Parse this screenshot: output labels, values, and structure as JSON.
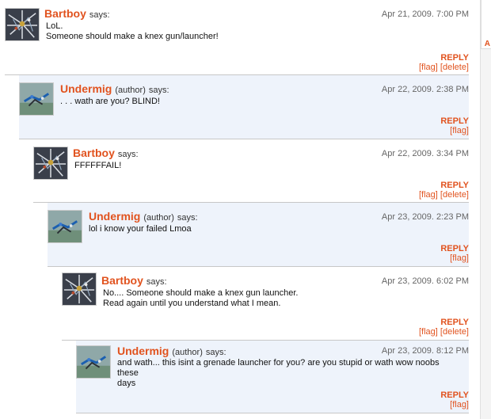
{
  "comments": [
    {
      "username": "Bartboy",
      "author_tag": "",
      "says": "says:",
      "date": "Apr 21, 2009. 7:00 PM",
      "lines": [
        "LoL.",
        "Someone should make a knex gun/launcher!"
      ],
      "reply_label": "REPLY",
      "flag_label": "[flag]",
      "delete_label": "[delete]",
      "avatar": "bartboy-avatar"
    },
    {
      "username": "Undermig",
      "author_tag": "(author)",
      "says": "says:",
      "date": "Apr 22, 2009. 2:38 PM",
      "lines": [
        ". . . wath are you? BLIND!"
      ],
      "reply_label": "REPLY",
      "flag_label": "[flag]",
      "delete_label": "",
      "avatar": "undermig-avatar"
    },
    {
      "username": "Bartboy",
      "author_tag": "",
      "says": "says:",
      "date": "Apr 22, 2009. 3:34 PM",
      "lines": [
        "FFFFFFAIL!"
      ],
      "reply_label": "REPLY",
      "flag_label": "[flag]",
      "delete_label": "[delete]",
      "avatar": "bartboy-avatar"
    },
    {
      "username": "Undermig",
      "author_tag": "(author)",
      "says": "says:",
      "date": "Apr 23, 2009. 2:23 PM",
      "lines": [
        "lol i know your failed Lmoa"
      ],
      "reply_label": "REPLY",
      "flag_label": "[flag]",
      "delete_label": "",
      "avatar": "undermig-avatar"
    },
    {
      "username": "Bartboy",
      "author_tag": "",
      "says": "says:",
      "date": "Apr 23, 2009. 6:02 PM",
      "lines": [
        "No.... Someone should make a knex gun launcher.",
        "Read again until you understand what I mean."
      ],
      "reply_label": "REPLY",
      "flag_label": "[flag]",
      "delete_label": "[delete]",
      "avatar": "bartboy-avatar"
    },
    {
      "username": "Undermig",
      "author_tag": "(author)",
      "says": "says:",
      "date": "Apr 23, 2009. 8:12 PM",
      "lines": [
        "and wath... this isint a grenade launcher for you? are you stupid or wath wow noobs these",
        "days"
      ],
      "reply_label": "REPLY",
      "flag_label": "[flag]",
      "delete_label": "",
      "avatar": "undermig-avatar"
    }
  ],
  "sidebar": {
    "letter": "A"
  },
  "colors": {
    "accent": "#e1531f",
    "alt_background": "#eef3fb",
    "divider": "#c7c7c7"
  }
}
